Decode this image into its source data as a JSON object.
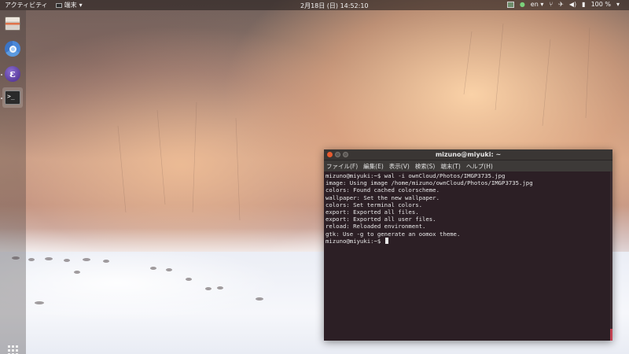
{
  "topbar": {
    "activities": "アクティビティ",
    "app_menu": "端末",
    "clock": "2月18日 (日) 14:52:10",
    "lang": "en",
    "battery": "100 %"
  },
  "dock": {
    "items": [
      {
        "name": "files",
        "icon": "files-icon"
      },
      {
        "name": "chromium",
        "icon": "chrome-icon"
      },
      {
        "name": "emacs",
        "icon": "emacs-icon"
      },
      {
        "name": "terminal",
        "icon": "terminal-icon",
        "active": true
      }
    ]
  },
  "terminal": {
    "title": "mizuno@miyuki: ~",
    "menu": [
      "ファイル(F)",
      "編集(E)",
      "表示(V)",
      "検索(S)",
      "端末(T)",
      "ヘルプ(H)"
    ],
    "lines": [
      "mizuno@miyuki:~$ wal -i ownCloud/Photos/IMGP3735.jpg",
      "image: Using image /home/mizuno/ownCloud/Photos/IMGP3735.jpg",
      "colors: Found cached colorscheme.",
      "wallpaper: Set the new wallpaper.",
      "colors: Set terminal colors.",
      "export: Exported all files.",
      "export: Exported all user files.",
      "reload: Reloaded environment.",
      "gtk: Use -g to generate an oomox theme.",
      "mizuno@miyuki:~$ "
    ]
  },
  "colors": {
    "terminal_bg": "#2c1f25",
    "close_button": "#e85b2f",
    "scroll_thumb": "#c04050"
  }
}
